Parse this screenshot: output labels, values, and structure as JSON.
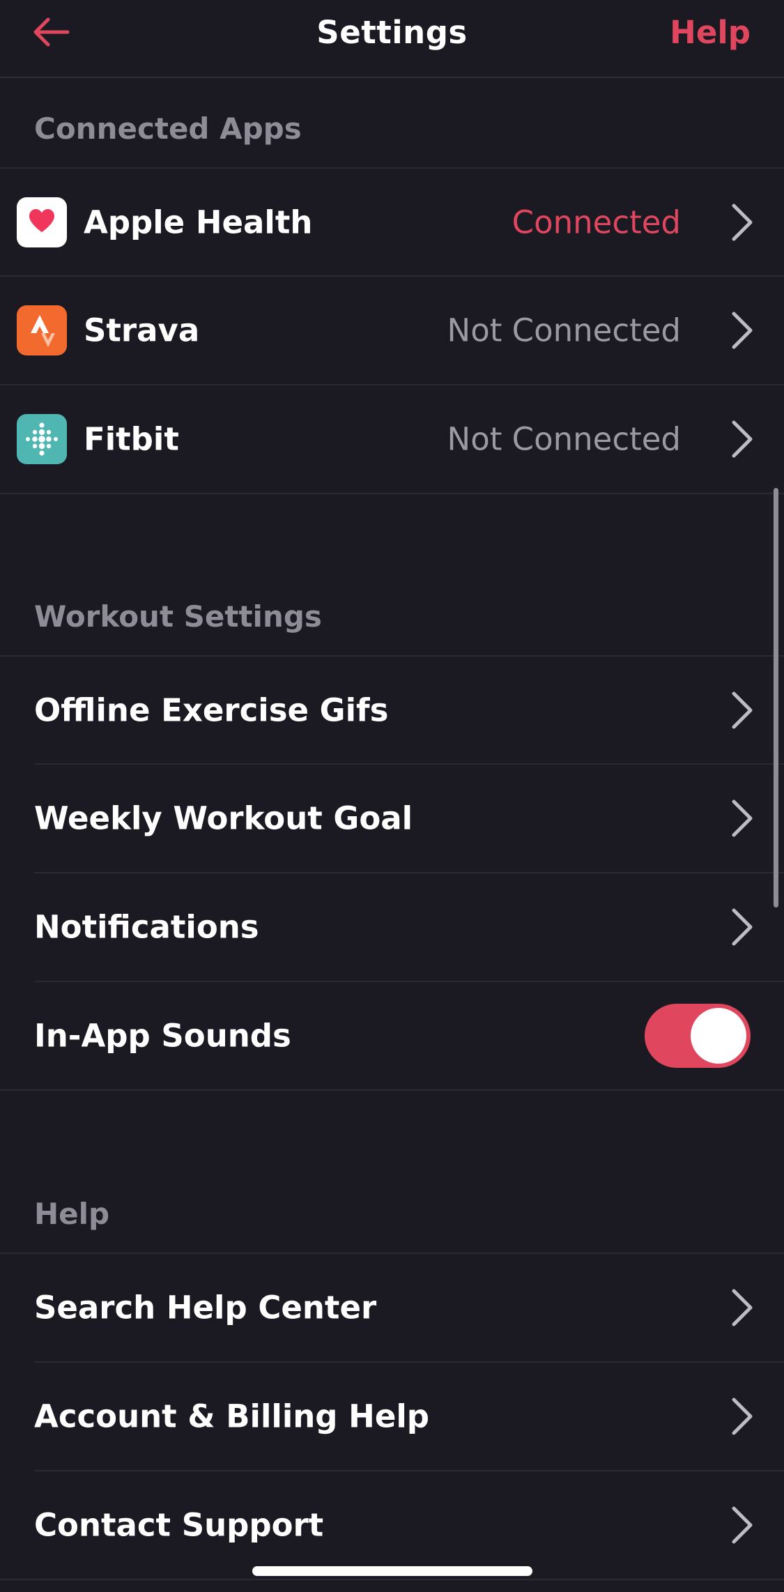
{
  "header": {
    "title": "Settings",
    "help_label": "Help",
    "back_icon": "arrow-left-icon"
  },
  "colors": {
    "accent": "#e0475e",
    "background": "#1b1a23",
    "section_header": "#8e8c97",
    "status_off": "#9b9aa3"
  },
  "connected_apps": {
    "title": "Connected Apps",
    "items": [
      {
        "label": "Apple Health",
        "status": "Connected",
        "icon": "apple-health-icon"
      },
      {
        "label": "Strava",
        "status": "Not Connected",
        "icon": "strava-icon"
      },
      {
        "label": "Fitbit",
        "status": "Not Connected",
        "icon": "fitbit-icon"
      }
    ]
  },
  "workout_settings": {
    "title": "Workout Settings",
    "items": [
      {
        "label": "Offline Exercise Gifs"
      },
      {
        "label": "Weekly Workout Goal"
      },
      {
        "label": "Notifications"
      },
      {
        "label": "In-App Sounds",
        "toggle": true
      }
    ]
  },
  "help": {
    "title": "Help",
    "items": [
      {
        "label": "Search Help Center"
      },
      {
        "label": "Account & Billing Help"
      },
      {
        "label": "Contact Support"
      }
    ]
  }
}
